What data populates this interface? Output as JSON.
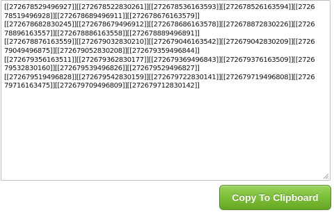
{
  "textarea": {
    "lines": [
      "[[272678529496927]][[272678522830261]][[272678536163593]][[272678526163594]][[2726",
      "78519496928]][[272678689496911]][[272678676163579]]",
      "[[272678682830245]][[272678679496912]][[272678686163578]][[272678872830226]][[2726",
      "78896163557]][[272678886163558]][[272678889496891]]",
      "[[272678876163559]][[272679032830210]][[272679046163542]][[272679042830209]][[2726",
      "79049496875]][[272679052830208]][[272679359496844]]",
      "[[272679356163511]][[272679362830177]][[272679369496843]][[272679376163509]][[2726",
      "79532830160]][[272679539496826]][[272679529496827]]",
      "[[272679519496828]][[272679542830159]][[272679722830141]][[272679719496808]][[2726",
      "79716163475]][[272679709496809]][[272679712830142]]"
    ]
  },
  "copy_button": {
    "label": "Copy To Clipboard"
  }
}
